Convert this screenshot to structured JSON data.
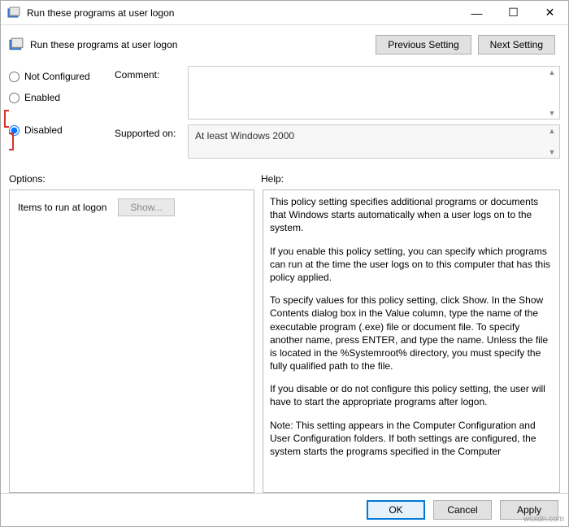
{
  "titlebar": {
    "text": "Run these programs at user logon"
  },
  "header": {
    "text": "Run these programs at user logon"
  },
  "nav": {
    "prev": "Previous Setting",
    "next": "Next Setting"
  },
  "radios": {
    "not_configured": "Not Configured",
    "enabled": "Enabled",
    "disabled": "Disabled",
    "selected": "disabled"
  },
  "commentLabel": "Comment:",
  "supportedLabel": "Supported on:",
  "supportedText": "At least Windows 2000",
  "labels": {
    "options": "Options:",
    "help": "Help:"
  },
  "options": {
    "itemsLabel": "Items to run at logon",
    "showBtn": "Show..."
  },
  "help": {
    "p1": "This policy setting specifies additional programs or documents that Windows starts automatically when a user logs on to the system.",
    "p2": "If you enable this policy setting, you can specify which programs can run at the time the user logs on to this computer that has this policy applied.",
    "p3": "To specify values for this policy setting, click Show. In the Show Contents dialog box in the Value column, type the name of the executable program (.exe) file or document file. To specify another name, press ENTER, and type the name. Unless the file is located in the %Systemroot% directory, you must specify the fully qualified path to the file.",
    "p4": "If you disable or do not configure this policy setting, the user will have to start the appropriate programs after logon.",
    "p5": "Note: This setting appears in the Computer Configuration and User Configuration folders. If both settings are configured, the system starts the programs specified in the Computer"
  },
  "footer": {
    "ok": "OK",
    "cancel": "Cancel",
    "apply": "Apply"
  },
  "watermark": "wsxdn.com"
}
